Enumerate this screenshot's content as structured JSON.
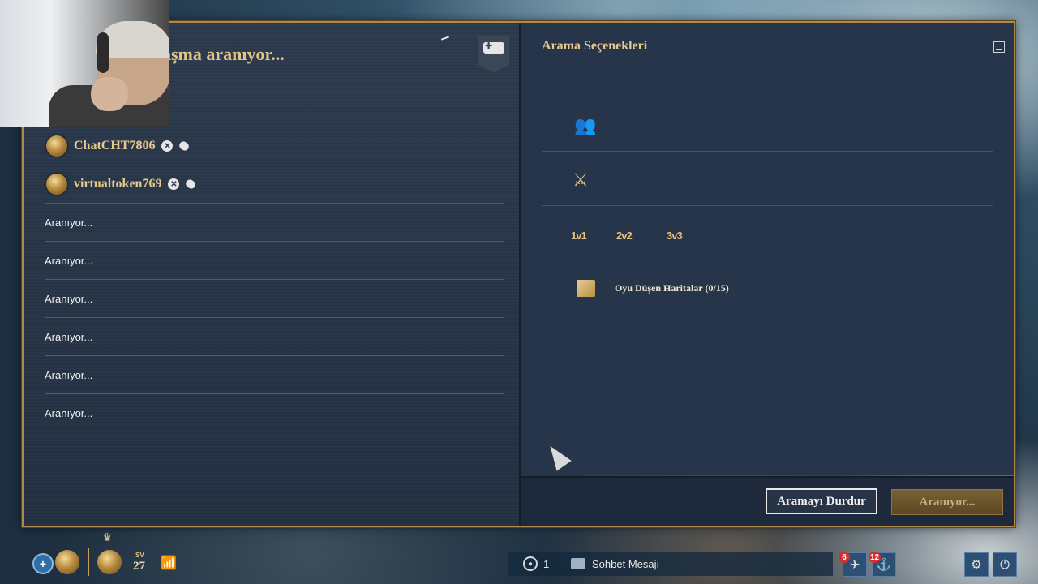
{
  "lobby": {
    "title": "aşma aranıyor...",
    "players": [
      {
        "name": "ChatCHT7806"
      },
      {
        "name": "virtualtoken769"
      }
    ],
    "searching_slots": [
      "Aranıyor...",
      "Aranıyor...",
      "Aranıyor...",
      "Aranıyor...",
      "Aranıyor...",
      "Aranıyor..."
    ]
  },
  "options": {
    "title": "Arama Seçenekleri",
    "team_sizes": [
      "1v1",
      "2v2",
      "3v3"
    ],
    "maps_label": "Oyu Düşen Haritalar (0/15)"
  },
  "buttons": {
    "stop_search": "Aramayı Durdur",
    "searching": "Aranıyor..."
  },
  "bottom_bar": {
    "sv_label": "SV",
    "sv_value": "27",
    "party_count": "1",
    "chat_placeholder": "Sohbet Mesajı",
    "notif_alerts": "6",
    "notif_messages": "12"
  },
  "colors": {
    "gold_text": "#e8c98c",
    "panel_bg": "#26354a",
    "frame_border": "#b08a4d",
    "notification": "#d62e2e"
  },
  "icons": {
    "team": "people-icon",
    "mode": "crossed-swords-icon",
    "map": "map-icon"
  }
}
